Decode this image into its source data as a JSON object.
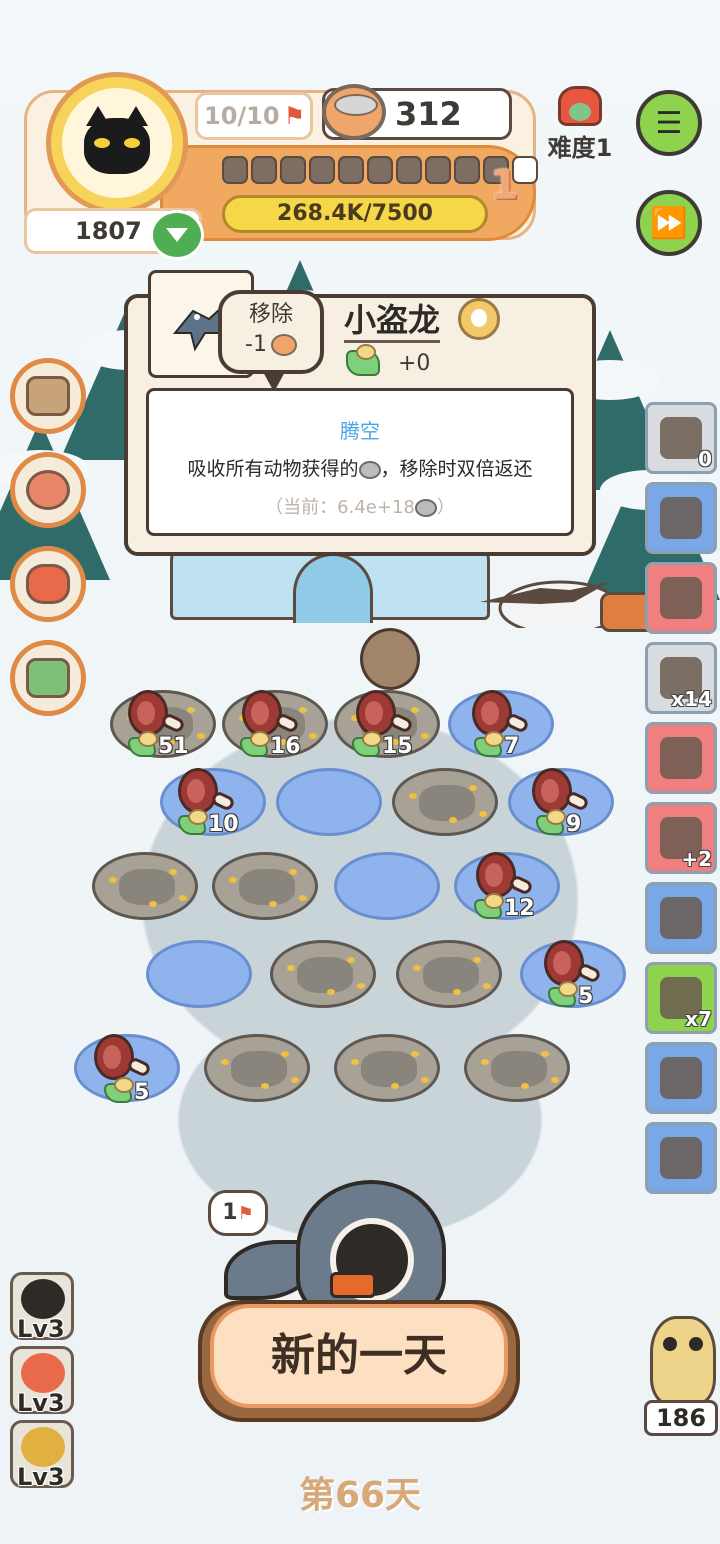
{
  "hud": {
    "score": "1807",
    "flags": "10/10",
    "money": "312",
    "level": "1",
    "xp": "268.4K/7500",
    "segments_total": 11,
    "segments_filled": 1,
    "difficulty": "难度1"
  },
  "tooltip": {
    "remove_label": "移除",
    "remove_cost": "-1",
    "name": "小盗龙",
    "gain": "+0",
    "skill_name": "腾空",
    "skill_text_before": "吸收所有动物获得的",
    "skill_text_after": "，移除时双倍返还",
    "current_before": "（当前：6.4e+18",
    "current_after": "）"
  },
  "right_tiles": [
    {
      "name": "coin-pouch",
      "count": "0",
      "color": "gray"
    },
    {
      "name": "blue-tool",
      "count": "",
      "color": "blue"
    },
    {
      "name": "crystal",
      "count": "",
      "color": "pink"
    },
    {
      "name": "machine",
      "count": "x14",
      "color": "gray"
    },
    {
      "name": "butcher-tools",
      "count": "",
      "color": "pink"
    },
    {
      "name": "plus-two-pouch",
      "count": "+2",
      "color": "pink"
    },
    {
      "name": "drying-rack",
      "count": "",
      "color": "blue"
    },
    {
      "name": "refresh-ticket",
      "count": "x7",
      "color": "green"
    },
    {
      "name": "hut",
      "count": "",
      "color": "blue"
    },
    {
      "name": "display-box",
      "count": "",
      "color": "blue"
    }
  ],
  "board": {
    "counts": [
      "51",
      "16",
      "15",
      "7",
      "10",
      "9",
      "12",
      "5",
      "5"
    ]
  },
  "shark_flags": "1",
  "new_day_label": "新的一天",
  "day_label": "第66天",
  "lv_items": [
    "Lv3",
    "Lv3",
    "Lv3"
  ],
  "owl_count": "186",
  "colors": {
    "accent_orange": "#f1a860",
    "green_button": "#8fd24e",
    "skill_blue": "#4aa6e6"
  }
}
